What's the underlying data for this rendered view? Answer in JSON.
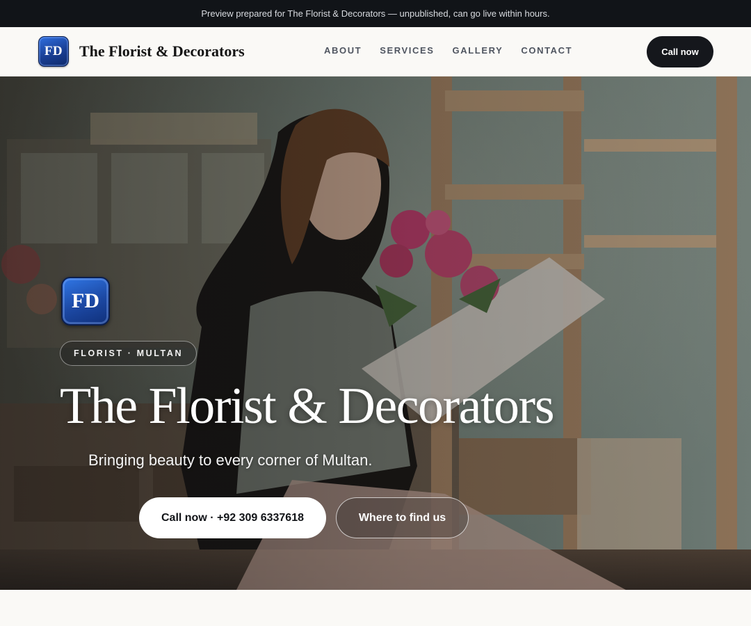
{
  "banner": {
    "text": "Preview prepared for The Florist & Decorators — unpublished, can go live within hours."
  },
  "header": {
    "logo_text": "FD",
    "brand_name": "The Florist & Decorators",
    "nav": [
      {
        "label": "ABOUT"
      },
      {
        "label": "SERVICES"
      },
      {
        "label": "GALLERY"
      },
      {
        "label": "CONTACT"
      }
    ],
    "cta_label": "Call now"
  },
  "hero": {
    "logo_text": "FD",
    "tag": "FLORIST · MULTAN",
    "title": "The Florist & Decorators",
    "subtitle": "Bringing beauty to every corner of Multan.",
    "primary_button": "Call now · +92 309 6337618",
    "secondary_button": "Where to find us"
  }
}
